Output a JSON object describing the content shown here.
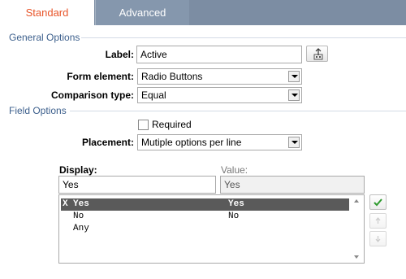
{
  "tabs": [
    {
      "label": "Standard",
      "active": true
    },
    {
      "label": "Advanced",
      "active": false
    }
  ],
  "general_options": {
    "title": "General Options",
    "label_field": {
      "label": "Label:",
      "value": "Active"
    },
    "form_element": {
      "label": "Form element:",
      "value": "Radio Buttons"
    },
    "comparison_type": {
      "label": "Comparison type:",
      "value": "Equal"
    }
  },
  "field_options": {
    "title": "Field Options",
    "required": {
      "label": "Required",
      "checked": false
    },
    "placement": {
      "label": "Placement:",
      "value": "Mutiple options per line"
    },
    "display": {
      "label": "Display:",
      "value": "Yes"
    },
    "value": {
      "label": "Value:",
      "value": "Yes"
    },
    "options": [
      {
        "marker": "X",
        "display": "Yes",
        "value": "Yes",
        "selected": true
      },
      {
        "marker": "",
        "display": "No",
        "value": "No",
        "selected": false
      },
      {
        "marker": "",
        "display": "Any",
        "value": "",
        "selected": false
      }
    ]
  },
  "icons": {
    "label_picker": "label-picker-icon",
    "apply": "checkmark-icon",
    "move_up": "arrow-up-icon",
    "move_down": "arrow-down-icon"
  },
  "colors": {
    "tab_bar": "#7c8da3",
    "active_tab_text": "#e8552a",
    "section_heading": "#3c5f8c",
    "selected_row": "#5a5a5a",
    "checkmark": "#2e9a2e"
  }
}
